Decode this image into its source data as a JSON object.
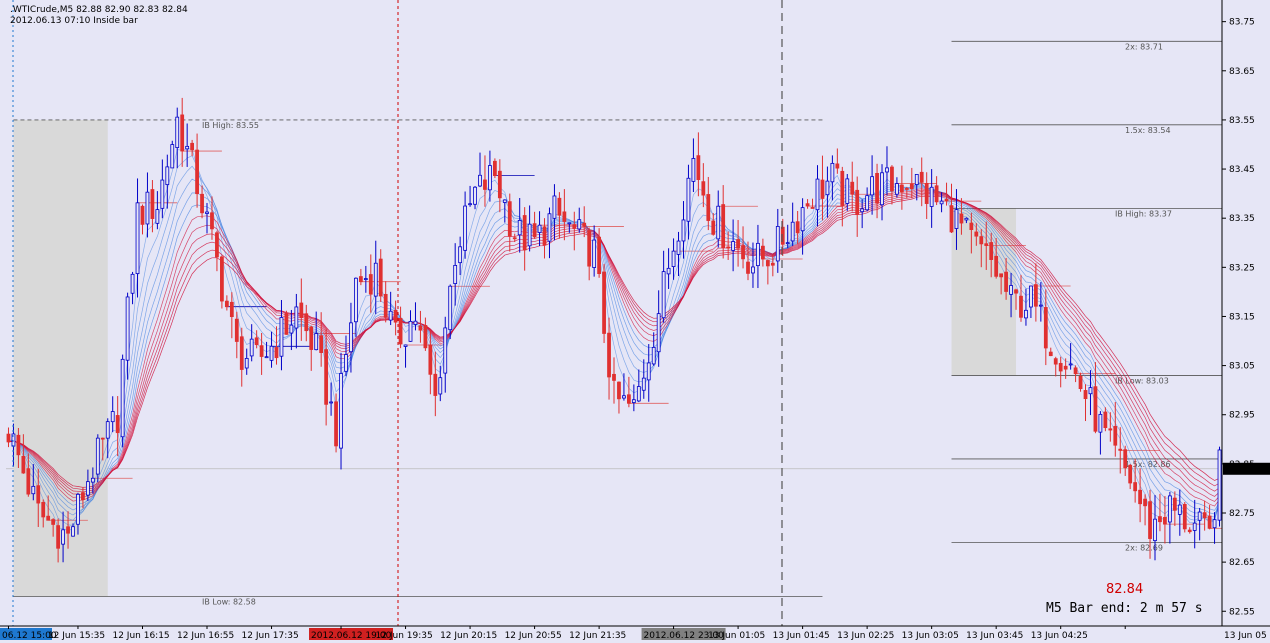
{
  "header": {
    "symbol_line": ".WTICrude,M5  82.88 82.90 82.83 82.84",
    "info_line": "2012.06.13 07:10 Inside bar"
  },
  "timer": {
    "price": "82.84",
    "bar_end": "M5 Bar end: 2 m 57 s"
  },
  "colors": {
    "background": "#e6e6f6",
    "bull_candle": "#0000c8",
    "bear_candle": "#e03030",
    "ribbon_fast": "#3f7fe0",
    "ribbon_slow": "#d0103a",
    "ib_box": "#d8d8d8",
    "current_price_tag": "#000000"
  },
  "chart_data": {
    "type": "candlestick",
    "symbol": ".WTICrude",
    "timeframe": "M5",
    "ylim": [
      82.52,
      83.79
    ],
    "y_ticks": [
      "83.75",
      "83.65",
      "83.55",
      "83.45",
      "83.35",
      "83.25",
      "83.15",
      "83.05",
      "82.95",
      "82.85",
      "82.75",
      "82.65",
      "82.55"
    ],
    "x_ticks": [
      "06.12 15:00",
      "12 Jun 15:35",
      "12 Jun 16:15",
      "12 Jun 16:55",
      "12 Jun 17:35",
      "2012.06.12 19:00",
      "12 Jun 19:35",
      "12 Jun 20:15",
      "12 Jun 20:55",
      "12 Jun 21:35",
      "2012.06.12 23:00",
      "13 Jun 01:05",
      "13 Jun 01:45",
      "13 Jun 02:25",
      "13 Jun 03:05",
      "13 Jun 03:45",
      "13 Jun 04:25",
      "13 Jun 05"
    ],
    "current_price": 82.84,
    "session_lines": [
      {
        "label": "2012.06.12 19:00",
        "style": "red-dotted"
      },
      {
        "label": "2012.06.12 23:00",
        "style": "grey-dashed"
      }
    ],
    "levels": [
      {
        "label": "IB High: 83.55",
        "value": 83.55
      },
      {
        "label": "IB Low: 82.58",
        "value": 82.58
      },
      {
        "label": "2x: 83.71",
        "value": 83.71
      },
      {
        "label": "1.5x: 83.54",
        "value": 83.54
      },
      {
        "label": "IB High: 83.37",
        "value": 83.37
      },
      {
        "label": "IB Low: 83.03",
        "value": 83.03
      },
      {
        "label": "1.5x: 82.86",
        "value": 82.86
      },
      {
        "label": "2x: 82.69",
        "value": 82.69
      }
    ],
    "close_path": [
      [
        0,
        82.92
      ],
      [
        6,
        82.75
      ],
      [
        12,
        82.7
      ],
      [
        16,
        82.82
      ],
      [
        22,
        82.95
      ],
      [
        26,
        83.36
      ],
      [
        30,
        83.38
      ],
      [
        34,
        83.55
      ],
      [
        38,
        83.42
      ],
      [
        42,
        83.26
      ],
      [
        46,
        83.08
      ],
      [
        50,
        83.06
      ],
      [
        54,
        83.1
      ],
      [
        58,
        83.16
      ],
      [
        62,
        83.08
      ],
      [
        66,
        82.92
      ],
      [
        70,
        83.22
      ],
      [
        74,
        83.24
      ],
      [
        78,
        83.1
      ],
      [
        82,
        83.15
      ],
      [
        86,
        82.98
      ],
      [
        90,
        83.28
      ],
      [
        94,
        83.4
      ],
      [
        98,
        83.44
      ],
      [
        102,
        83.32
      ],
      [
        106,
        83.3
      ],
      [
        110,
        83.36
      ],
      [
        114,
        83.32
      ],
      [
        118,
        83.28
      ],
      [
        122,
        82.98
      ],
      [
        126,
        82.96
      ],
      [
        130,
        83.12
      ],
      [
        134,
        83.3
      ],
      [
        138,
        83.47
      ],
      [
        142,
        83.35
      ],
      [
        146,
        83.3
      ],
      [
        150,
        83.26
      ],
      [
        154,
        83.28
      ],
      [
        158,
        83.34
      ],
      [
        162,
        83.4
      ],
      [
        166,
        83.43
      ],
      [
        170,
        83.38
      ],
      [
        174,
        83.41
      ],
      [
        178,
        83.42
      ],
      [
        182,
        83.43
      ],
      [
        186,
        83.39
      ],
      [
        190,
        83.36
      ],
      [
        194,
        83.3
      ],
      [
        198,
        83.26
      ],
      [
        202,
        83.18
      ],
      [
        206,
        83.18
      ],
      [
        210,
        83.1
      ],
      [
        214,
        83.05
      ],
      [
        218,
        82.97
      ],
      [
        222,
        82.88
      ],
      [
        226,
        82.82
      ],
      [
        230,
        82.72
      ],
      [
        234,
        82.76
      ],
      [
        238,
        82.73
      ],
      [
        242,
        82.7
      ],
      [
        244,
        82.84
      ]
    ]
  }
}
